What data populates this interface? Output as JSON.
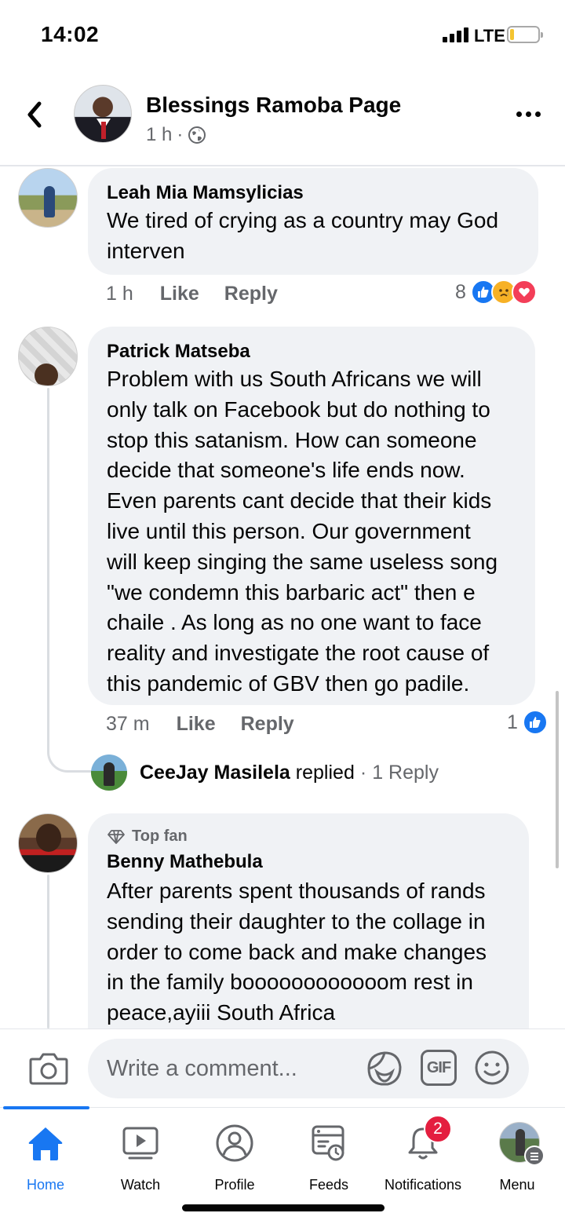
{
  "status_bar": {
    "time": "14:02",
    "network": "LTE"
  },
  "post_header": {
    "page_name": "Blessings Ramoba Page",
    "time_ago": "1 h",
    "separator": "·",
    "audience_icon": "globe-icon"
  },
  "comments": [
    {
      "author": "Leah Mia Mamsylicias",
      "text": "We tired of crying as a country may God\ninterven",
      "time": "1 h",
      "like_label": "Like",
      "reply_label": "Reply",
      "reaction_count": "8",
      "reactions": [
        "like",
        "sad",
        "love"
      ]
    },
    {
      "author": "Patrick Matseba",
      "text": "Problem with us South Africans we will\nonly talk on Facebook but do nothing to\nstop this satanism. How can someone\ndecide that someone's life ends now.\nEven parents cant decide that their kids\nlive until this person. Our government\nwill keep singing the same useless song\n\"we condemn this barbaric act\" then e\nchaile . As long as no one want to face\nreality and investigate the root cause of\nthis pandemic of GBV then go padile.",
      "time": "37 m",
      "like_label": "Like",
      "reply_label": "Reply",
      "reaction_count": "1",
      "reactions": [
        "like"
      ],
      "reply_preview": {
        "name": "CeeJay Masilela",
        "action": "replied",
        "separator": "·",
        "count_label": "1 Reply"
      }
    },
    {
      "badge": "Top fan",
      "author": "Benny Mathebula",
      "text": "After parents spent thousands of rands\nsending their daughter to the collage in\norder to come back and make changes\nin the family boooooooooooom rest in\npeace,ayiii South Africa"
    }
  ],
  "composer": {
    "placeholder": "Write a comment...",
    "gif_label": "GIF"
  },
  "tabs": [
    {
      "label": "Home",
      "icon": "home-icon",
      "active": true
    },
    {
      "label": "Watch",
      "icon": "watch-icon"
    },
    {
      "label": "Profile",
      "icon": "profile-icon"
    },
    {
      "label": "Feeds",
      "icon": "feeds-icon"
    },
    {
      "label": "Notifications",
      "icon": "bell-icon",
      "badge": "2"
    },
    {
      "label": "Menu",
      "icon": "menu-avatar"
    }
  ],
  "colors": {
    "accent": "#1877f2",
    "bubble": "#f0f2f5",
    "muted_text": "#65676b",
    "badge": "#e41e3f"
  }
}
